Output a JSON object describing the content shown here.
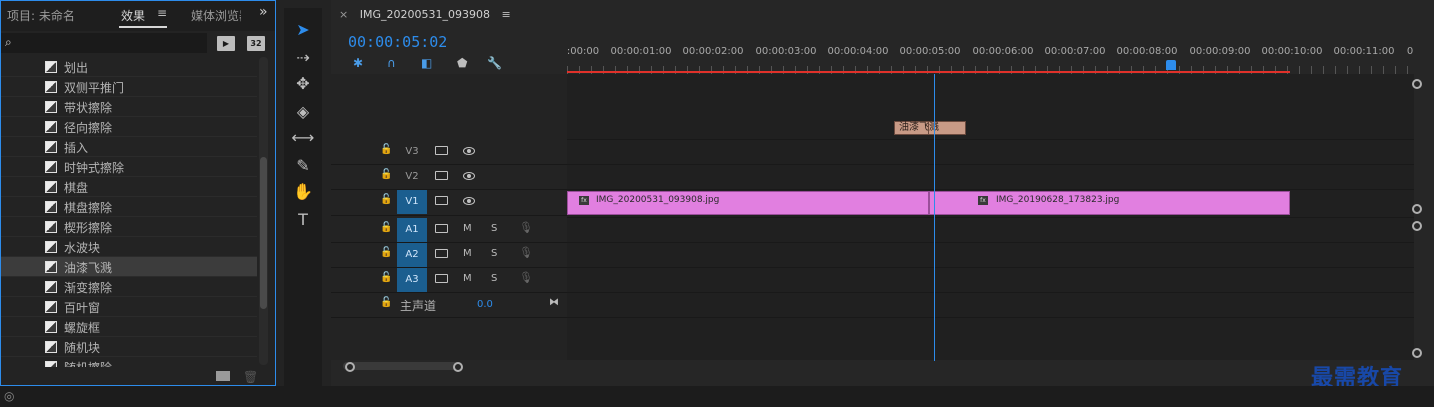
{
  "left_panel": {
    "tab_project": "项目: 未命名",
    "tab_effects": "效果",
    "tab_menu_icon": "≡",
    "tab_media": "媒体浏览器",
    "tab_more": "»",
    "search_icon": "⌕",
    "btn_accel_label": "▶",
    "btn_32_label": "32",
    "effects": [
      {
        "label": "划出",
        "selected": false
      },
      {
        "label": "双侧平推门",
        "selected": false
      },
      {
        "label": "带状擦除",
        "selected": false
      },
      {
        "label": "径向擦除",
        "selected": false
      },
      {
        "label": "插入",
        "selected": false
      },
      {
        "label": "时钟式擦除",
        "selected": false
      },
      {
        "label": "棋盘",
        "selected": false
      },
      {
        "label": "棋盘擦除",
        "selected": false
      },
      {
        "label": "楔形擦除",
        "selected": false
      },
      {
        "label": "水波块",
        "selected": false
      },
      {
        "label": "油漆飞溅",
        "selected": true
      },
      {
        "label": "渐变擦除",
        "selected": false
      },
      {
        "label": "百叶窗",
        "selected": false
      },
      {
        "label": "螺旋框",
        "selected": false
      },
      {
        "label": "随机块",
        "selected": false
      },
      {
        "label": "随机擦除",
        "selected": false
      }
    ],
    "delete_icon": "🗑"
  },
  "tools": {
    "select": "➤",
    "track_select": "⇢",
    "ripple": "✥",
    "razor": "◈",
    "slip": "⟷",
    "pen": "✎",
    "hand": "✋",
    "type": "T"
  },
  "timeline": {
    "close": "×",
    "sequence_name": "IMG_20200531_093908",
    "menu": "≡",
    "timecode": "00:00:05:02",
    "tool_icons": [
      "✱",
      "∩",
      "◧",
      "⬟",
      "🔧"
    ],
    "ruler_labels": [
      ":00:00",
      "00:00:01:00",
      "00:00:02:00",
      "00:00:03:00",
      "00:00:04:00",
      "00:00:05:00",
      "00:00:06:00",
      "00:00:07:00",
      "00:00:08:00",
      "00:00:09:00",
      "00:00:10:00",
      "00:00:11:00",
      "0"
    ],
    "lock_icon": "🔓",
    "tracks": {
      "V3": "V3",
      "V2": "V2",
      "V1": "V1",
      "A1": "A1",
      "A2": "A2",
      "A3": "A3",
      "mute": "M",
      "solo": "S",
      "mic": "🎙"
    },
    "master": {
      "label": "主声道",
      "volume": "0.0",
      "icon": "⧓"
    },
    "clips": [
      {
        "name": "IMG_20200531_093908.jpg",
        "fx": "fx"
      },
      {
        "name": "IMG_20190628_173823.jpg",
        "fx": "fx"
      }
    ],
    "transition": "油漆飞溅"
  },
  "watermark": "最需教育",
  "status_icon": "◎"
}
